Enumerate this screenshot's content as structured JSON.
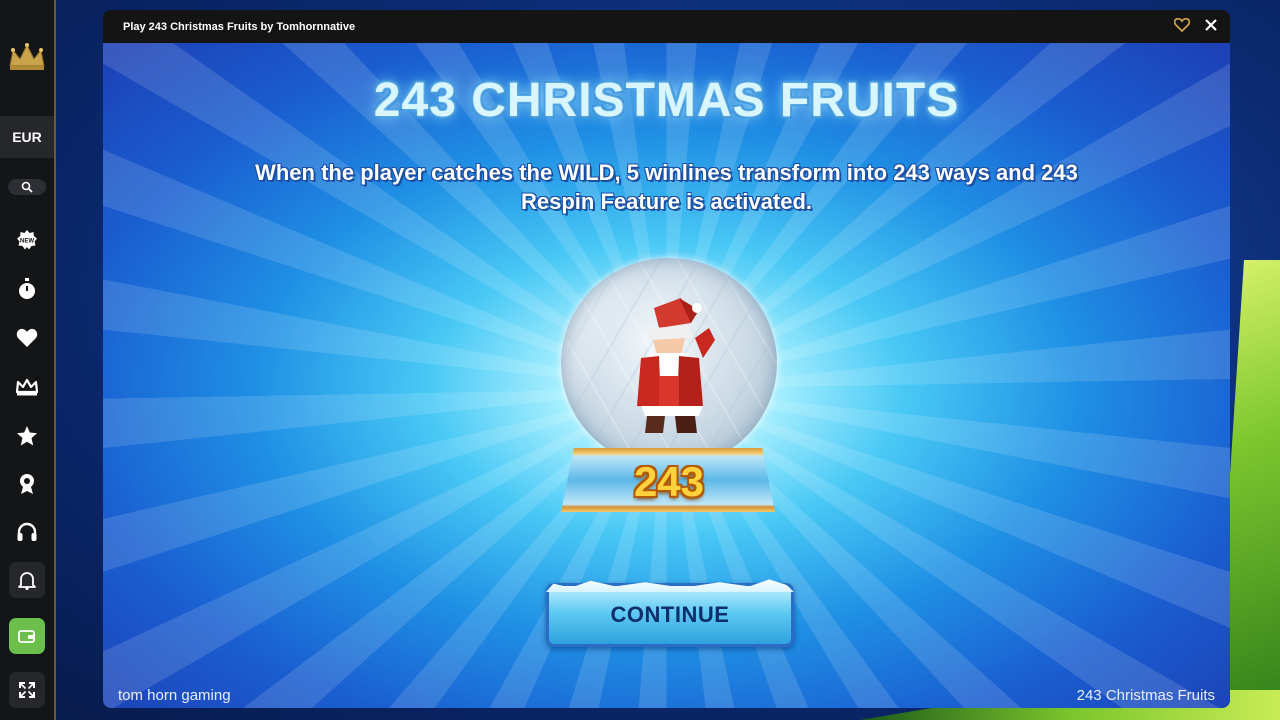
{
  "sidebar": {
    "currency": "EUR",
    "icons": [
      "crown-logo",
      "search-icon",
      "new-badge-icon",
      "stopwatch-icon",
      "heart-icon",
      "crown-icon",
      "star-icon",
      "trophy-icon",
      "headset-icon",
      "bell-icon",
      "wallet-icon",
      "expand-icon"
    ]
  },
  "window": {
    "title": "Play 243 Christmas Fruits by Tomhornnative"
  },
  "game": {
    "title": "243 CHRISTMAS FRUITS",
    "description": "When the player catches the WILD, 5 winlines transform into 243 ways and 243 Respin Feature is activated.",
    "globe_value": "243",
    "continue_label": "CONTINUE",
    "footer_left": "tom horn gaming",
    "footer_right": "243 Christmas Fruits"
  },
  "colors": {
    "sidebar_bg": "#141516",
    "accent_gold": "#c9a24a",
    "wallet_green": "#6cbf4a"
  }
}
